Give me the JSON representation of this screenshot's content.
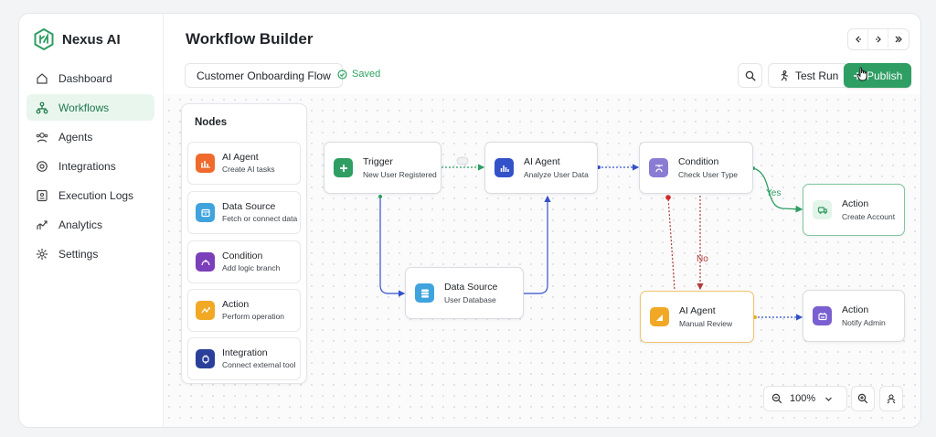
{
  "app": {
    "name": "Nexus AI"
  },
  "nav": [
    {
      "label": "Dashboard",
      "icon": "home-icon",
      "active": false
    },
    {
      "label": "Workflows",
      "icon": "workflow-icon",
      "active": true
    },
    {
      "label": "Agents",
      "icon": "agents-icon",
      "active": false
    },
    {
      "label": "Integrations",
      "icon": "integrations-icon",
      "active": false
    },
    {
      "label": "Execution Logs",
      "icon": "logs-icon",
      "active": false
    },
    {
      "label": "Analytics",
      "icon": "analytics-icon",
      "active": false
    },
    {
      "label": "Settings",
      "icon": "gear-icon",
      "active": false
    }
  ],
  "header": {
    "title": "Workflow Builder"
  },
  "toolbar": {
    "flow_name": "Customer Onboarding Flow",
    "status": "Saved",
    "test_label": "Test Run",
    "publish_label": "Publish"
  },
  "palette": {
    "title": "Nodes",
    "items": [
      {
        "name": "AI Agent",
        "desc": "Create AI tasks",
        "color": "#ef6a2c"
      },
      {
        "name": "Data Source",
        "desc": "Fetch or connect data",
        "color": "#3fa3dd"
      },
      {
        "name": "Condition",
        "desc": "Add logic branch",
        "color": "#7a3fb9"
      },
      {
        "name": "Action",
        "desc": "Perform operation",
        "color": "#f1a925"
      },
      {
        "name": "Integration",
        "desc": "Connect external tool",
        "color": "#2a3f9a"
      }
    ]
  },
  "nodes": {
    "trigger": {
      "title": "Trigger",
      "sub": "New User Registered",
      "color": "#2e9e63"
    },
    "agent": {
      "title": "AI Agent",
      "sub": "Analyze User Data",
      "color": "#3352c9"
    },
    "condition": {
      "title": "Condition",
      "sub": "Check User Type",
      "color": "#8a7bd3"
    },
    "datasource": {
      "title": "Data Source",
      "sub": "User Database",
      "color": "#3fa3dd"
    },
    "create": {
      "title": "Action",
      "sub": "Create Account",
      "color": "#2e9e63"
    },
    "review": {
      "title": "AI Agent",
      "sub": "Manual Review",
      "color": "#f1a925"
    },
    "notify": {
      "title": "Action",
      "sub": "Notify Admin",
      "color": "#7a5fd1"
    }
  },
  "edges": {
    "yes_label": "Yes",
    "no_label": "No"
  },
  "zoom": {
    "level": "100%"
  }
}
